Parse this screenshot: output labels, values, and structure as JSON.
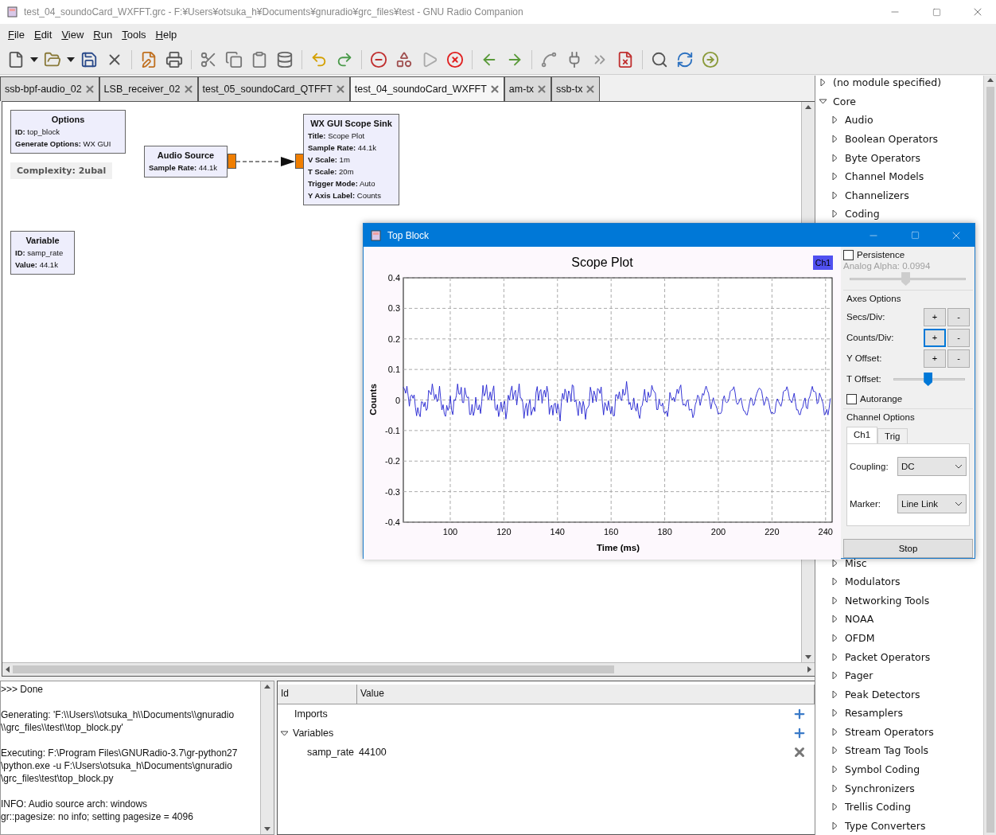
{
  "window": {
    "title": "test_04_soundoCard_WXFFT.grc - F:¥Users¥otsuka_h¥Documents¥gnuradio¥grc_files¥test - GNU Radio Companion"
  },
  "menu": [
    {
      "label": "File"
    },
    {
      "label": "Edit"
    },
    {
      "label": "View"
    },
    {
      "label": "Run"
    },
    {
      "label": "Tools"
    },
    {
      "label": "Help"
    }
  ],
  "tabs": [
    {
      "label": "ssb-bpf-audio_02",
      "selected": false
    },
    {
      "label": "LSB_receiver_02",
      "selected": false
    },
    {
      "label": "test_05_soundoCard_QTFFT",
      "selected": false
    },
    {
      "label": "test_04_soundoCard_WXFFT",
      "selected": true
    },
    {
      "label": "am-tx",
      "selected": false
    },
    {
      "label": "ssb-tx",
      "selected": false
    }
  ],
  "flowgraph": {
    "blocks": [
      {
        "title": "Options",
        "params": [
          {
            "key": "ID:",
            "value": "top_block"
          },
          {
            "key": "Generate Options:",
            "value": "WX GUI"
          }
        ]
      },
      {
        "title": "Audio Source",
        "params": [
          {
            "key": "Sample Rate:",
            "value": "44.1k"
          }
        ]
      },
      {
        "title": "WX GUI Scope Sink",
        "params": [
          {
            "key": "Title:",
            "value": "Scope Plot"
          },
          {
            "key": "Sample Rate:",
            "value": "44.1k"
          },
          {
            "key": "V Scale:",
            "value": "1m"
          },
          {
            "key": "T Scale:",
            "value": "20m"
          },
          {
            "key": "Trigger Mode:",
            "value": "Auto"
          },
          {
            "key": "Y Axis Label:",
            "value": "Counts"
          }
        ]
      },
      {
        "title": "Variable",
        "params": [
          {
            "key": "ID:",
            "value": "samp_rate"
          },
          {
            "key": "Value:",
            "value": "44.1k"
          }
        ]
      }
    ],
    "complexity": "Complexity: 2ubal"
  },
  "console": {
    "messages": [
      ">>> Done",
      "Generating: 'F:\\\\Users\\\\otsuka_h\\\\Documents\\\\gnuradio\n\\\\grc_files\\\\test\\\\top_block.py'",
      "Executing: F:\\Program Files\\GNURadio-3.7\\gr-python27\n\\python.exe -u F:\\Users\\otsuka_h\\Documents\\gnuradio\n\\grc_files\\test\\top_block.py",
      "INFO: Audio source arch: windows\ngr::pagesize: no info; setting pagesize = 4096"
    ]
  },
  "variables": {
    "columns": [
      "Id",
      "Value"
    ],
    "rows": [
      {
        "kind": "group",
        "label": "Imports"
      },
      {
        "kind": "group",
        "label": "Variables",
        "expanded": true,
        "children": [
          {
            "id": "samp_rate",
            "value": "44100"
          }
        ]
      }
    ]
  },
  "library": {
    "items": [
      {
        "label": "(no module specified)",
        "expanded": false
      },
      {
        "label": "Core",
        "expanded": true,
        "children": [
          {
            "label": "Audio",
            "expanded": false
          },
          {
            "label": "Boolean Operators",
            "expanded": false
          },
          {
            "label": "Byte Operators",
            "expanded": false
          },
          {
            "label": "Channel Models",
            "expanded": false
          },
          {
            "label": "Channelizers",
            "expanded": false
          },
          {
            "label": "Coding",
            "expanded": false
          },
          {
            "label": "Misc",
            "expanded": false
          },
          {
            "label": "Modulators",
            "expanded": false
          },
          {
            "label": "Networking Tools",
            "expanded": false
          },
          {
            "label": "NOAA",
            "expanded": false
          },
          {
            "label": "OFDM",
            "expanded": false
          },
          {
            "label": "Packet Operators",
            "expanded": false
          },
          {
            "label": "Pager",
            "expanded": false
          },
          {
            "label": "Peak Detectors",
            "expanded": false
          },
          {
            "label": "Resamplers",
            "expanded": false
          },
          {
            "label": "Stream Operators",
            "expanded": false
          },
          {
            "label": "Stream Tag Tools",
            "expanded": false
          },
          {
            "label": "Symbol Coding",
            "expanded": false
          },
          {
            "label": "Synchronizers",
            "expanded": false
          },
          {
            "label": "Trellis Coding",
            "expanded": false
          },
          {
            "label": "Type Converters",
            "expanded": false
          }
        ]
      }
    ]
  },
  "scope_window": {
    "title": "Top Block",
    "plot": {
      "title": "Scope Plot",
      "legend": "Ch1",
      "ylabel": "Counts",
      "xlabel": "Time (ms)",
      "yticks": [
        "0.4",
        "0.3",
        "0.2",
        "0.1",
        "0",
        "-0.1",
        "-0.2",
        "-0.3",
        "-0.4"
      ],
      "xticks": [
        "100",
        "120",
        "140",
        "160",
        "180",
        "200",
        "220",
        "240"
      ]
    },
    "persistence": {
      "label": "Persistence",
      "checked": false
    },
    "alpha": {
      "label": "Analog Alpha: 0.0994",
      "disabled": true,
      "level": 0.48
    },
    "axes": {
      "title": "Axes Options",
      "rows": [
        {
          "label": "Secs/Div:",
          "plus": "+",
          "minus": "-",
          "focused": false
        },
        {
          "label": "Counts/Div:",
          "plus": "+",
          "minus": "-",
          "focused": true
        },
        {
          "label": "Y Offset:",
          "plus": "+",
          "minus": "-",
          "focused": false
        }
      ],
      "t_offset": {
        "label": "T Offset:",
        "level": 0.48
      }
    },
    "autorange": {
      "label": "Autorange",
      "checked": false
    },
    "channel": {
      "title": "Channel Options",
      "tabs": [
        {
          "label": "Ch1",
          "selected": true
        },
        {
          "label": "Trig",
          "selected": false
        }
      ],
      "coupling": {
        "label": "Coupling:",
        "value": "DC"
      },
      "marker": {
        "label": "Marker:",
        "value": "Line Link"
      }
    },
    "stop": "Stop"
  }
}
